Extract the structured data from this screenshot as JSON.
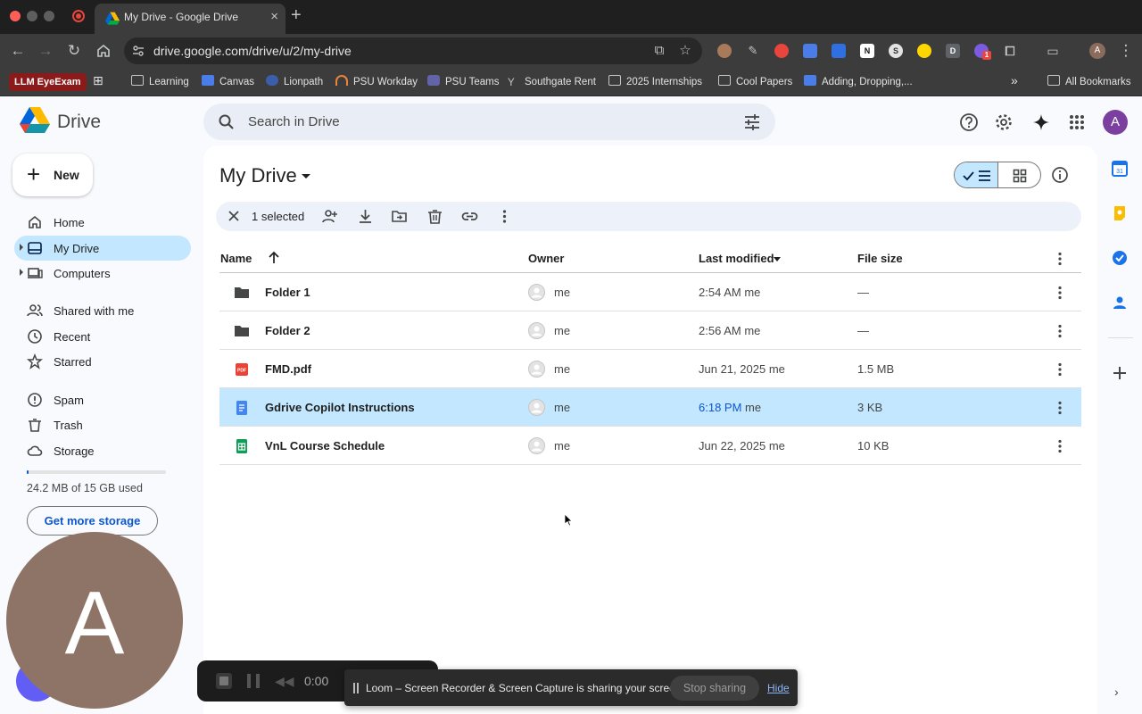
{
  "browser": {
    "tab_title": "My Drive - Google Drive",
    "tab_close": "×",
    "new_tab": "+",
    "url": "drive.google.com/drive/u/2/my-drive",
    "chrome_avatar": "A",
    "ext_badge": "1",
    "colors": {
      "close": "#ff5f57",
      "minimize": "#febc2e",
      "maximize": "#28c840"
    }
  },
  "bookmarks": {
    "llm": "LLM EyeExam",
    "items": [
      "Learning",
      "Canvas",
      "Lionpath",
      "PSU Workday",
      "PSU Teams",
      "Southgate Rent",
      "2025 Internships",
      "Cool Papers",
      "Adding, Dropping,..."
    ],
    "overflow": "»",
    "all": "All Bookmarks"
  },
  "drive": {
    "logo_text": "Drive",
    "search_placeholder": "Search in Drive",
    "account_initial": "A",
    "new_label": "New",
    "new_plus": "+",
    "nav": [
      "Home",
      "My Drive",
      "Computers",
      "Shared with me",
      "Recent",
      "Starred",
      "Spam",
      "Trash",
      "Storage"
    ],
    "storage_text": "24.2 MB of 15 GB used",
    "storage_fraction": 0.0016,
    "get_more_storage": "Get more storage",
    "page_title": "My Drive",
    "selected_text": "1 selected",
    "columns": {
      "name": "Name",
      "owner": "Owner",
      "modified": "Last modified",
      "size": "File size"
    },
    "files": [
      {
        "name": "Folder 1",
        "type": "folder",
        "owner": "me",
        "mod_time": "2:54 AM",
        "mod_by": "me",
        "size": "—",
        "selected": false
      },
      {
        "name": "Folder 2",
        "type": "folder",
        "owner": "me",
        "mod_time": "2:56 AM",
        "mod_by": "me",
        "size": "—",
        "selected": false
      },
      {
        "name": "FMD.pdf",
        "type": "pdf",
        "owner": "me",
        "mod_time": "Jun 21, 2025",
        "mod_by": "me",
        "size": "1.5 MB",
        "selected": false
      },
      {
        "name": "Gdrive Copilot Instructions",
        "type": "doc",
        "owner": "me",
        "mod_time": "6:18 PM",
        "mod_by": "me",
        "size": "3 KB",
        "selected": true
      },
      {
        "name": "VnL Course Schedule",
        "type": "sheet",
        "owner": "me",
        "mod_time": "Jun 22, 2025",
        "mod_by": "me",
        "size": "10 KB",
        "selected": false
      }
    ],
    "accent": "#0b57d0",
    "selected_bg": "#c2e7ff"
  },
  "loom": {
    "bubble_letter": "A",
    "timer": "0:00",
    "share_text": "Loom – Screen Recorder & Screen Capture is sharing your screen.",
    "stop_sharing": "Stop sharing",
    "hide": "Hide"
  }
}
